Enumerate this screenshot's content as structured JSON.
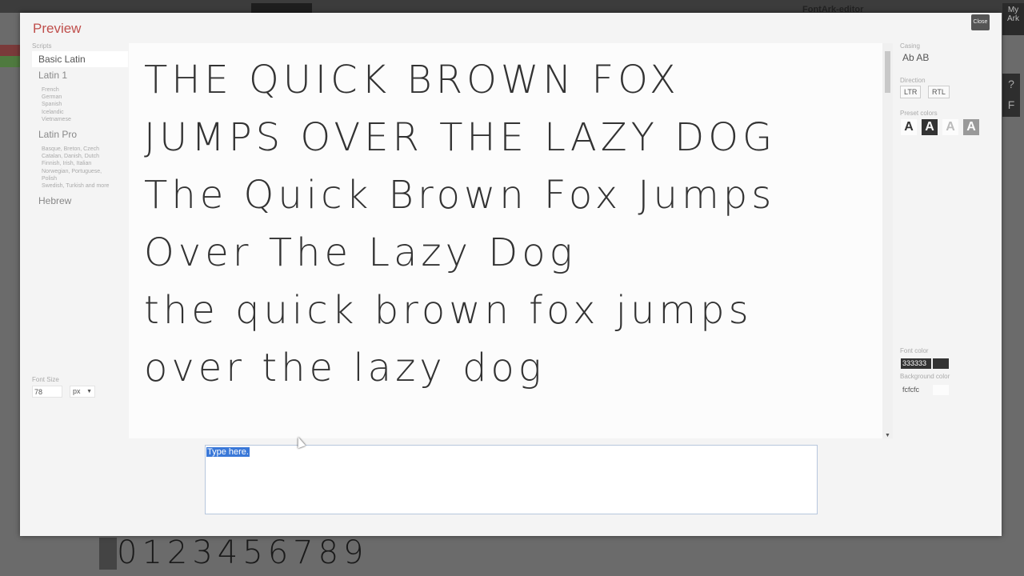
{
  "modal": {
    "title": "Preview",
    "close_label": "Close"
  },
  "sidebar": {
    "scripts_label": "Scripts",
    "items": [
      {
        "label": "Basic Latin"
      },
      {
        "label": "Latin 1",
        "sub": [
          "French",
          "German",
          "Spanish",
          "Icelandic",
          "Vietnamese"
        ]
      },
      {
        "label": "Latin Pro",
        "sub": [
          "Basque, Breton, Czech",
          "Catalan, Danish, Dutch",
          "Finnish, Irish, Italian",
          "Norwegian, Portuguese,",
          "Polish",
          "Swedish, Turkish and more"
        ]
      },
      {
        "label": "Hebrew"
      }
    ],
    "font_size_label": "Font Size",
    "font_size_value": "78",
    "font_size_unit": "px"
  },
  "preview": {
    "lines": [
      "THE QUICK BROWN FOX",
      "JUMPS OVER THE LAZY DOG",
      "The Quick Brown Fox Jumps",
      "Over The Lazy Dog",
      "the quick brown fox jumps",
      "over the lazy dog"
    ]
  },
  "type_box": {
    "text": "Type here."
  },
  "right_panel": {
    "casing_label": "Casing",
    "casing_value": "Ab  AB",
    "direction_label": "Direction",
    "ltr_label": "LTR",
    "rtl_label": "RTL",
    "preset_label": "Preset colors",
    "preset_glyph": "A",
    "font_color_label": "Font color",
    "font_color_value": "333333",
    "bg_color_label": "Background color",
    "bg_color_value": "fcfcfc"
  },
  "background_app": {
    "title": "FontArk-editor",
    "my_ark": "My Ark",
    "digits": "0123456789"
  },
  "colors": {
    "accent": "#c0504d",
    "font_color": "#333333",
    "background_color": "#fcfcfc",
    "selection": "#3a78d8"
  }
}
